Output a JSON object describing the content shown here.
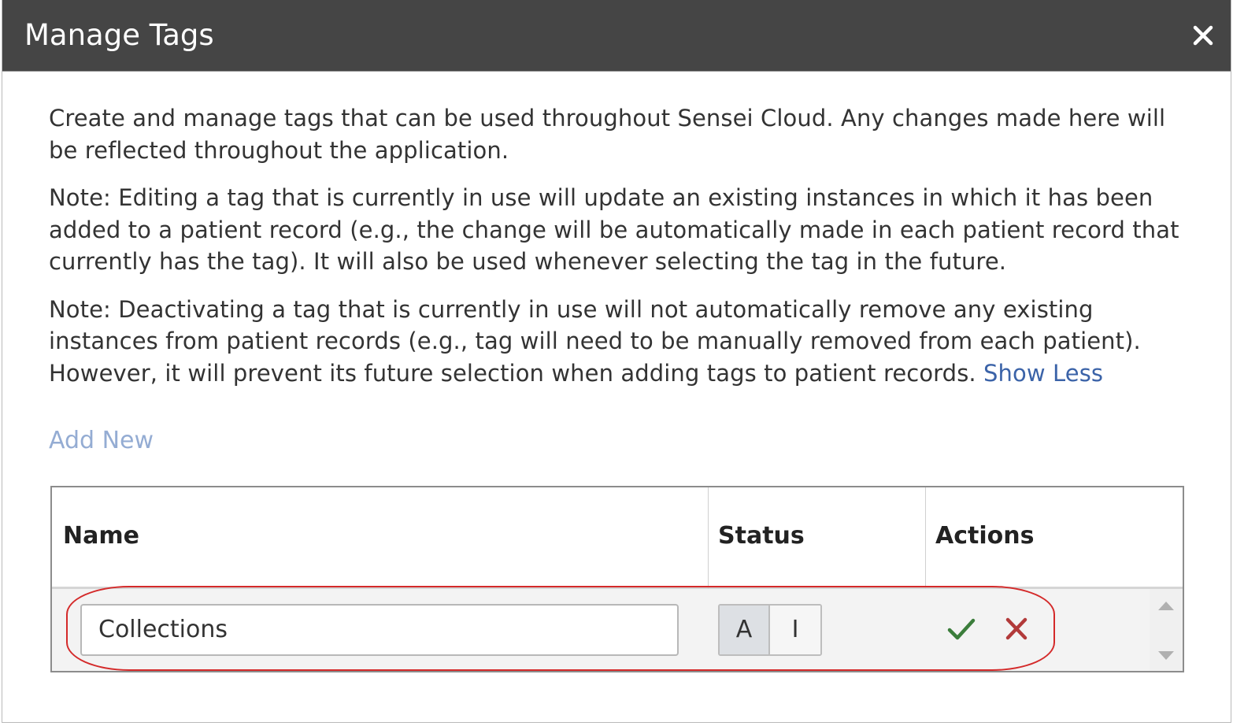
{
  "dialog": {
    "title": "Manage Tags",
    "close_icon": "close-icon"
  },
  "description": {
    "paragraph1": "Create and manage tags that can be used throughout Sensei Cloud. Any changes made here will be reflected throughout the application.",
    "paragraph2": "Note: Editing a tag that is currently in use will update an existing instances in which it has been added to a patient record (e.g., the change will be automatically made in each patient record that currently has the tag). It will also be used whenever selecting the tag in the future.",
    "paragraph3": "Note: Deactivating a tag that is currently in use will not automatically remove any existing instances from patient records (e.g., tag will need to be manually removed from each patient). However, it will prevent its future selection when adding tags to patient records.",
    "show_less_link": "Show Less"
  },
  "add_new_label": "Add New",
  "table": {
    "columns": [
      "Name",
      "Status",
      "Actions"
    ],
    "rows": [
      {
        "name_value": "Collections",
        "status_options": [
          "A",
          "I"
        ],
        "status_selected": "A",
        "actions": [
          "check-icon",
          "x-icon"
        ]
      }
    ]
  },
  "colors": {
    "titlebar": "#454545",
    "link": "#3b63a8",
    "add_new": "#94acd3",
    "confirm": "#3b7d3b",
    "cancel": "#b23a3a",
    "highlight": "#d42a2a"
  }
}
